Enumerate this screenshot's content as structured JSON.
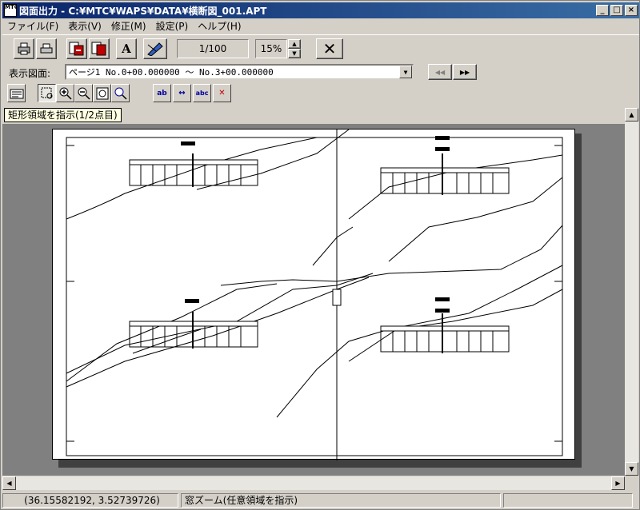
{
  "window": {
    "app_icon_text": "MTC",
    "title": "図面出力 - C:¥MTC¥WAPS¥DATA¥横断図_001.APT",
    "minimize": "_",
    "maximize": "□",
    "close": "×"
  },
  "menu": [
    {
      "label": "ファイル(F)"
    },
    {
      "label": "表示(V)"
    },
    {
      "label": "修正(M)"
    },
    {
      "label": "設定(P)"
    },
    {
      "label": "ヘルプ(H)"
    }
  ],
  "toolbar": {
    "text_button_label": "A",
    "scale": "1/100",
    "zoom": "15%",
    "close_glyph": "✕"
  },
  "page_selector": {
    "label": "表示図面:",
    "value": "ページ1 No.0+00.000000 〜 No.3+00.000000",
    "prev": "◀◀",
    "next": "▶▶"
  },
  "tools": {
    "t1": "ab",
    "t2": "↔",
    "t3": "abc",
    "t4": "✕"
  },
  "tooltip": "矩形領域を指示(1/2点目)",
  "status": {
    "coordinates": "(36.15582192, 3.52739726)",
    "message": "窓ズーム(任意領域を指示)"
  },
  "colors": {
    "title_start": "#0a246a",
    "title_end": "#3a6ea5",
    "face": "#d4d0c8",
    "canvas_bg": "#808080"
  }
}
